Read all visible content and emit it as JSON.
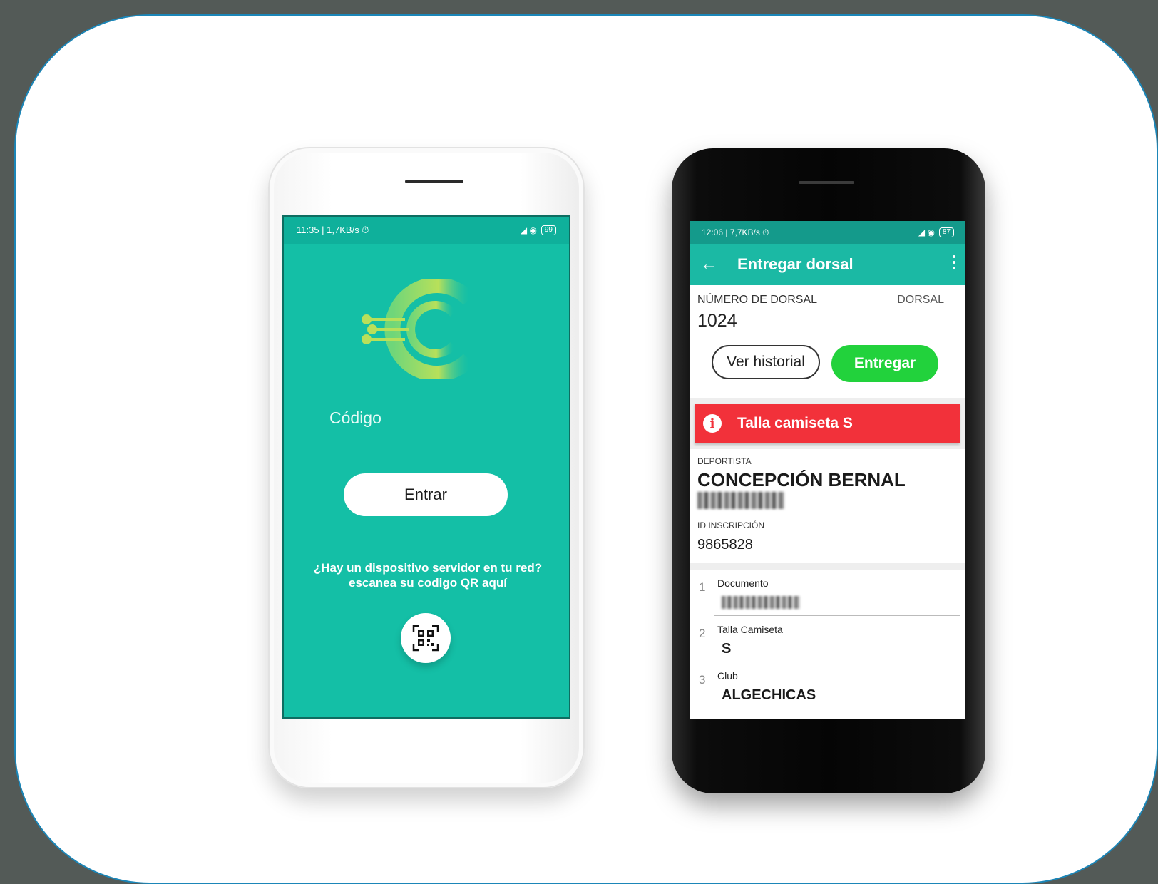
{
  "phone_left": {
    "status_bar": {
      "left": "11:35 | 1,7KB/s ⏱",
      "right_signal": "◢ ◉",
      "battery": "99"
    },
    "logo_icon": "tech-c-logo-icon",
    "code_field": {
      "placeholder": "Código",
      "value": ""
    },
    "enter_button": "Entrar",
    "qr_prompt_line1": "¿Hay un dispositivo servidor en tu red?",
    "qr_prompt_line2": "escanea su codigo QR aquí",
    "qr_button_icon": "qr-code-icon",
    "colors": {
      "screen": "#14bfa6",
      "status_bar": "#0fb09b"
    }
  },
  "phone_right": {
    "status_bar": {
      "left": "12:06 | 7,7KB/s ⏱",
      "right_signal": "◢ ◉",
      "battery": "87"
    },
    "appbar": {
      "back_icon": "arrow-left-icon",
      "title": "Entregar dorsal",
      "menu_icon": "more-vertical-icon"
    },
    "dorsal": {
      "number_label": "NÚMERO DE DORSAL",
      "number_value": "1024",
      "dorsal_label": "DORSAL"
    },
    "buttons": {
      "history": "Ver historial",
      "deliver": "Entregar"
    },
    "alert": {
      "icon": "info-icon",
      "text": "Talla camiseta S"
    },
    "athlete": {
      "label": "DEPORTISTA",
      "name": "CONCEPCIÓN BERNAL",
      "id_label": "ID INSCRIPCIÓN",
      "id_value": "9865828"
    },
    "fields": [
      {
        "index": "1",
        "label": "Documento",
        "value": ""
      },
      {
        "index": "2",
        "label": "Talla Camiseta",
        "value": "S"
      },
      {
        "index": "3",
        "label": "Club",
        "value": "ALGECHICAS"
      }
    ],
    "colors": {
      "appbar": "#1bb9a4",
      "deliver_button": "#22d23c",
      "alert": "#f2313a"
    }
  }
}
